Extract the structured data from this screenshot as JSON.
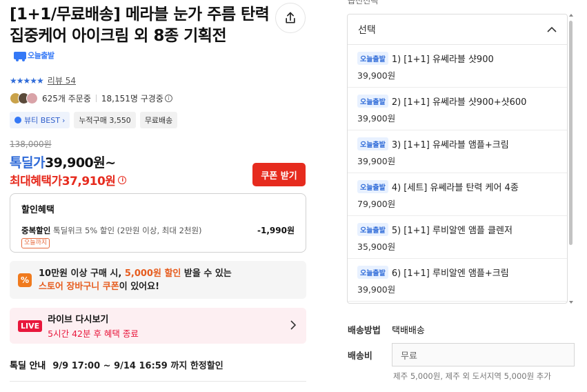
{
  "product": {
    "title": "[1+1/무료배송] 메라블 눈가 주름 탄력 집중케어 아이크림 외 8종 기획전",
    "delivery_badge": "오늘출발"
  },
  "rating": {
    "stars": "★★★★★",
    "review_label": "리뷰 54"
  },
  "buyers": {
    "orders": "625개 주문중",
    "viewers": "18,151명 구경중"
  },
  "tags": [
    "뷰티 BEST",
    "누적구매 3,550",
    "무료배송"
  ],
  "price": {
    "original": "138,000원",
    "deal_label": "톡딜가",
    "deal_value": "39,900원~",
    "max_label": "최대혜택가",
    "max_value": "37,910원",
    "coupon_button": "쿠폰 받기"
  },
  "discount": {
    "title": "할인혜택",
    "item_label": "중복할인",
    "item_desc": "톡딜위크 5% 할인 (2만원 이상, 최대 2천원)",
    "item_badge": "오늘까지",
    "item_amount": "-1,990원"
  },
  "cart_promo": {
    "icon": "%",
    "line1_a": "10만원 이상 구매 시, ",
    "line1_b": "5,000원 할인",
    "line1_c": " 받을 수 있는",
    "line2_a": "스토어 장바구니 쿠폰",
    "line2_b": "이 있어요!"
  },
  "live": {
    "badge": "LIVE",
    "title": "라이브 다시보기",
    "subtitle": "5시간 42분 후 혜택 종료"
  },
  "special": {
    "label": "톡딜 안내",
    "value": "9/9 17:00 ~ 9/14 16:59 까지 한정할인"
  },
  "options": {
    "header": "옵션선택",
    "select_label": "선택",
    "items": [
      {
        "badge": "오늘출발",
        "name": "1) [1+1] 유쎄라블 샷900",
        "price": "39,900원"
      },
      {
        "badge": "오늘출발",
        "name": "2) [1+1] 유쎄라블 샷900+샷600",
        "price": "39,900원"
      },
      {
        "badge": "오늘출발",
        "name": "3) [1+1] 유쎄라블 앰플+크림",
        "price": "39,900원"
      },
      {
        "badge": "오늘출발",
        "name": "4) [세트] 유쎄라블 탄력 케어 4종",
        "price": "79,900원"
      },
      {
        "badge": "오늘출발",
        "name": "5) [1+1] 루비알엔 앰플 클렌저",
        "price": "35,900원"
      },
      {
        "badge": "오늘출발",
        "name": "6) [1+1] 루비알엔 앰플+크림",
        "price": "39,900원"
      }
    ]
  },
  "shipping": {
    "method_label": "배송방법",
    "method_value": "택배배송",
    "fee_label": "배송비",
    "fee_value": "무료",
    "note": "제주 5,000원, 제주 외 도서지역 5,000원 추가"
  },
  "colors": {
    "accent_blue": "#2f6bd8",
    "accent_red": "#e62b1e",
    "live_red": "#e8173c",
    "promo_orange": "#f07a1d"
  }
}
